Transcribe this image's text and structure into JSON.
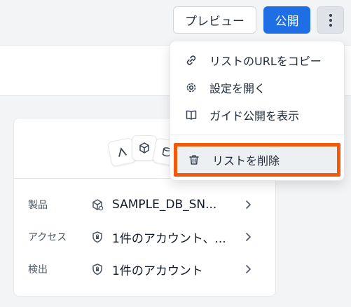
{
  "topbar": {
    "preview_label": "プレビュー",
    "publish_label": "公開"
  },
  "menu": {
    "items": [
      {
        "label": "リストのURLをコピー",
        "icon": "link-icon"
      },
      {
        "label": "設定を開く",
        "icon": "gear-icon"
      },
      {
        "label": "ガイド公開を表示",
        "icon": "book-icon"
      }
    ],
    "delete": {
      "label": "リストを削除",
      "icon": "trash-icon"
    }
  },
  "card": {
    "rows": [
      {
        "label": "製品",
        "value": "SAMPLE_DB_SN...",
        "icon": "product-icon"
      },
      {
        "label": "アクセス",
        "value": "1件のアカウント、...",
        "icon": "shield-lock-icon"
      },
      {
        "label": "検出",
        "value": "1件のアカウント",
        "icon": "shield-lock-icon"
      }
    ]
  },
  "colors": {
    "accent": "#1e6fe6",
    "highlight": "#f05a0c"
  }
}
